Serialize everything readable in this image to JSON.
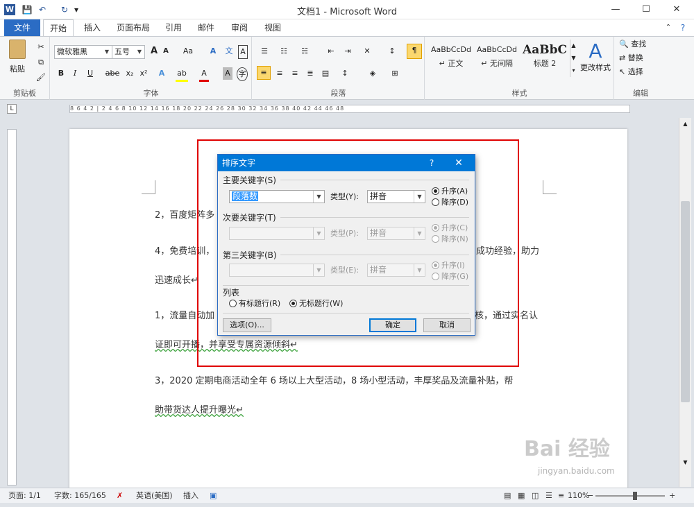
{
  "window": {
    "title": "文档1 - Microsoft Word",
    "minimize": "—",
    "maximize": "☐",
    "close": "✕"
  },
  "qat": {
    "logo": "W",
    "save": "💾",
    "undo": "↶",
    "redo": "↻",
    "customize": "▾"
  },
  "tabs": [
    "文件",
    "开始",
    "插入",
    "页面布局",
    "引用",
    "邮件",
    "审阅",
    "视图"
  ],
  "ribbon": {
    "clipboard": {
      "paste": "粘贴",
      "label": "剪贴板"
    },
    "font": {
      "font_name": "微软雅黑",
      "font_size": "五号",
      "grow": "A",
      "shrink": "A",
      "case": "Aa",
      "clear": "A",
      "bold": "B",
      "italic": "I",
      "underline": "U",
      "strike": "abe",
      "sub": "x₂",
      "sup": "x²",
      "label": "字体"
    },
    "paragraph": {
      "label": "段落"
    },
    "styles": {
      "items": [
        {
          "sample": "AaBbCcDd",
          "name": "↵ 正文"
        },
        {
          "sample": "AaBbCcDd",
          "name": "↵ 无间隔"
        },
        {
          "sample": "AaBbC",
          "name": "标题 2"
        }
      ],
      "change": "更改样式",
      "label": "样式"
    },
    "editing": {
      "find": "查找",
      "replace": "替换",
      "select": "选择",
      "label": "编辑"
    }
  },
  "ruler": {
    "text": "8  6  4  2  |  2  4  6  8  10  12  14  16  18  20  22  24  26  28  30  32  34  36  38  40  42  44  46  48"
  },
  "document": {
    "lines": [
      "2，百度矩阵多",
      "4，免费培训，",
      "成功经验，助力",
      "迅速成长↵",
      "1，流量自动加",
      "核，通过实名认",
      "证即可开播，并享受专属资源倾斜↵",
      "3，2020 定期电商活动全年 6 场以上大型活动，8 场小型活动，丰厚奖品及流量补贴，帮",
      "助带货达人提升曝光↵"
    ]
  },
  "dialog": {
    "title": "排序文字",
    "help": "?",
    "close": "✕",
    "primary": {
      "label": "主要关键字(S)",
      "key_value": "段落数",
      "type_label": "类型(Y):",
      "type_value": "拼音",
      "asc": "升序(A)",
      "desc": "降序(D)"
    },
    "secondary": {
      "label": "次要关键字(T)",
      "key_value": "",
      "type_label": "类型(P):",
      "type_value": "拼音",
      "asc": "升序(C)",
      "desc": "降序(N)"
    },
    "tertiary": {
      "label": "第三关键字(B)",
      "key_value": "",
      "type_label": "类型(E):",
      "type_value": "拼音",
      "asc": "升序(I)",
      "desc": "降序(G)"
    },
    "list": {
      "label": "列表",
      "header_row": "有标题行(R)",
      "no_header_row": "无标题行(W)"
    },
    "options_button": "选项(O)...",
    "ok_button": "确定",
    "cancel_button": "取消"
  },
  "status": {
    "page": "页面: 1/1",
    "words": "字数: 165/165",
    "language": "英语(美国)",
    "insert": "插入",
    "zoom": "110%",
    "zoom_minus": "−",
    "zoom_plus": "+"
  },
  "watermark": {
    "text": "Bai 经验",
    "url": "jingyan.baidu.com"
  },
  "colors": {
    "accent": "#2b6cc4",
    "dialog_title": "#0078d7",
    "highlight": "#e00000"
  }
}
